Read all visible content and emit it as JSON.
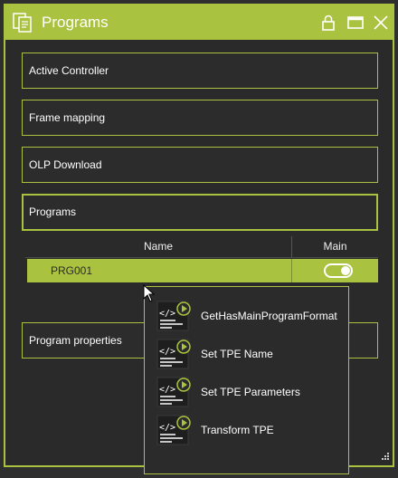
{
  "window": {
    "title": "Programs"
  },
  "sections": [
    {
      "label": "Active Controller"
    },
    {
      "label": "Frame mapping"
    },
    {
      "label": "OLP Download"
    },
    {
      "label": "Programs"
    },
    {
      "label": "Program properties"
    }
  ],
  "table": {
    "columns": [
      "Name",
      "Main"
    ],
    "rows": [
      {
        "name": "PRG001",
        "main": true
      }
    ]
  },
  "context_menu": {
    "items": [
      {
        "label": "GetHasMainProgramFormat",
        "icon": "code-run-icon"
      },
      {
        "label": "Set TPE Name",
        "icon": "code-run-icon"
      },
      {
        "label": "Set TPE Parameters",
        "icon": "code-run-icon"
      },
      {
        "label": "Transform TPE",
        "icon": "code-run-icon"
      }
    ]
  },
  "colors": {
    "accent": "#a9c23f",
    "background": "#2a2a2a"
  }
}
